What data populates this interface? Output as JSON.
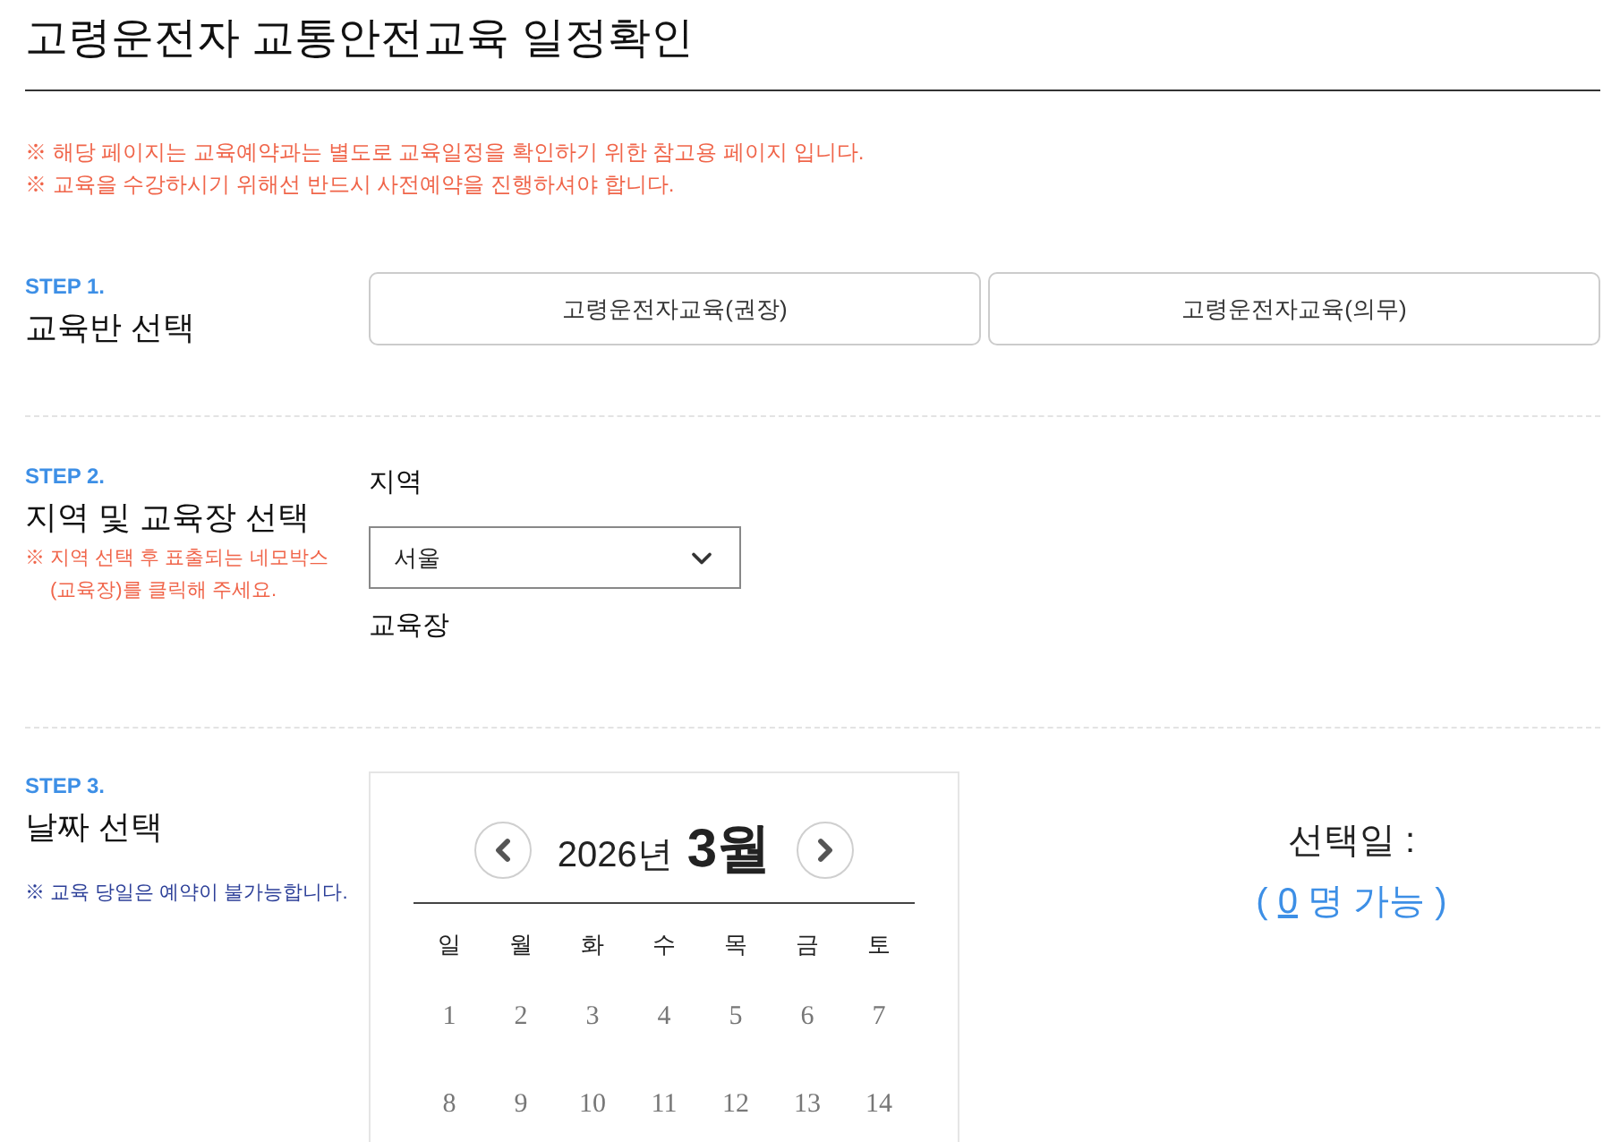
{
  "page": {
    "title": "고령운전자 교통안전교육 일정확인"
  },
  "notices": [
    "※ 해당 페이지는 교육예약과는 별도로 교육일정을 확인하기 위한 참고용 페이지 입니다.",
    "※ 교육을 수강하시기 위해선 반드시 사전예약을 진행하셔야 합니다."
  ],
  "steps": [
    {
      "kind": "course",
      "step": "STEP 1.",
      "title": "교육반 선택",
      "courses": [
        {
          "label": "고령운전자교육(권장)",
          "selected": false
        },
        {
          "label": "고령운전자교육(의무)",
          "selected": false
        }
      ]
    },
    {
      "kind": "location",
      "step": "STEP 2.",
      "title": "지역 및 교육장 선택",
      "note": {
        "kind": "warning",
        "text": "※ 지역 선택 후 표출되는 네모박스 (교육장)를 클릭해 주세요."
      },
      "region_label": "지역",
      "region_value": "서울",
      "venue_label": "교육장"
    },
    {
      "kind": "date",
      "step": "STEP 3.",
      "title": "날짜 선택",
      "note": {
        "kind": "info",
        "text": "※ 교육 당일은 예약이 불가능합니다."
      },
      "calendar": {
        "year": "2026년",
        "month": "3월",
        "weekdays": [
          "일",
          "월",
          "화",
          "수",
          "목",
          "금",
          "토"
        ],
        "weeks": [
          [
            "1",
            "2",
            "3",
            "4",
            "5",
            "6",
            "7"
          ],
          [
            "8",
            "9",
            "10",
            "11",
            "12",
            "13",
            "14"
          ]
        ]
      },
      "selection": {
        "label": "선택일 :",
        "prefix": "(",
        "count": "0",
        "suffix": "명 가능 )"
      }
    }
  ]
}
